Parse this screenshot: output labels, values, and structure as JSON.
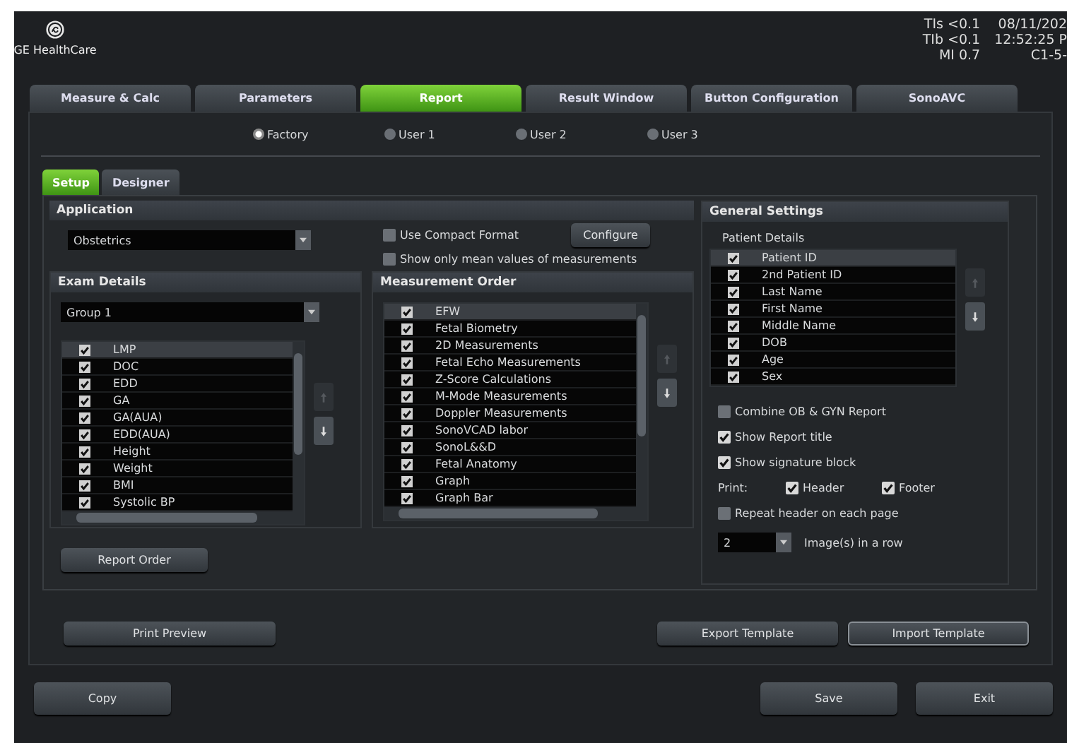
{
  "header": {
    "logo_text": "GE HealthCare",
    "indices": [
      "TIs <0.1",
      "TIb <0.1",
      "MI 0.7"
    ],
    "date": "08/11/202",
    "time": "12:52:25 P",
    "probe": "C1-5-"
  },
  "tabs": [
    {
      "label": "Measure & Calc",
      "selected": false
    },
    {
      "label": "Parameters",
      "selected": false
    },
    {
      "label": "Report",
      "selected": true
    },
    {
      "label": "Result Window",
      "selected": false
    },
    {
      "label": "Button Configuration",
      "selected": false
    },
    {
      "label": "SonoAVC",
      "selected": false
    }
  ],
  "presets": [
    {
      "label": "Factory",
      "selected": true
    },
    {
      "label": "User 1",
      "selected": false
    },
    {
      "label": "User 2",
      "selected": false
    },
    {
      "label": "User 3",
      "selected": false
    }
  ],
  "sub_tabs": [
    {
      "label": "Setup",
      "selected": true
    },
    {
      "label": "Designer",
      "selected": false
    }
  ],
  "application": {
    "title": "Application",
    "value": "Obstetrics"
  },
  "format_options": [
    {
      "label": "Use Compact Format",
      "checked": false
    },
    {
      "label": "Show only mean values of measurements",
      "checked": false
    }
  ],
  "configure_button": "Configure",
  "exam_details": {
    "title": "Exam Details",
    "group": "Group 1",
    "move_buttons": [
      {
        "kind": "up",
        "disabled": true
      },
      {
        "kind": "down",
        "disabled": false
      }
    ],
    "items": [
      {
        "label": "LMP",
        "checked": true,
        "selected": true
      },
      {
        "label": "DOC",
        "checked": true,
        "selected": false
      },
      {
        "label": "EDD",
        "checked": true,
        "selected": false
      },
      {
        "label": "GA",
        "checked": true,
        "selected": false
      },
      {
        "label": "GA(AUA)",
        "checked": true,
        "selected": false
      },
      {
        "label": "EDD(AUA)",
        "checked": true,
        "selected": false
      },
      {
        "label": "Height",
        "checked": true,
        "selected": false
      },
      {
        "label": "Weight",
        "checked": true,
        "selected": false
      },
      {
        "label": "BMI",
        "checked": true,
        "selected": false
      },
      {
        "label": "Systolic BP",
        "checked": true,
        "selected": false
      }
    ]
  },
  "measurement_order": {
    "title": "Measurement Order",
    "move_buttons": [
      {
        "kind": "up",
        "disabled": true
      },
      {
        "kind": "down",
        "disabled": false
      }
    ],
    "items": [
      {
        "label": "EFW",
        "checked": true,
        "selected": true
      },
      {
        "label": "Fetal Biometry",
        "checked": true,
        "selected": false
      },
      {
        "label": "2D Measurements",
        "checked": true,
        "selected": false
      },
      {
        "label": "Fetal Echo Measurements",
        "checked": true,
        "selected": false
      },
      {
        "label": "Z-Score Calculations",
        "checked": true,
        "selected": false
      },
      {
        "label": "M-Mode Measurements",
        "checked": true,
        "selected": false
      },
      {
        "label": "Doppler Measurements",
        "checked": true,
        "selected": false
      },
      {
        "label": "SonoVCAD labor",
        "checked": true,
        "selected": false
      },
      {
        "label": "SonoL&&D",
        "checked": true,
        "selected": false
      },
      {
        "label": "Fetal Anatomy",
        "checked": true,
        "selected": false
      },
      {
        "label": "Graph",
        "checked": true,
        "selected": false
      },
      {
        "label": "Graph Bar",
        "checked": true,
        "selected": false
      }
    ]
  },
  "report_order_button": "Report Order",
  "general_settings": {
    "title": "General Settings",
    "patient_details_label": "Patient Details",
    "move_buttons": [
      {
        "kind": "up",
        "disabled": true
      },
      {
        "kind": "down",
        "disabled": false
      }
    ],
    "items": [
      {
        "label": "Patient ID",
        "checked": true,
        "selected": true
      },
      {
        "label": "2nd Patient ID",
        "checked": true,
        "selected": false
      },
      {
        "label": "Last Name",
        "checked": true,
        "selected": false
      },
      {
        "label": "First Name",
        "checked": true,
        "selected": false
      },
      {
        "label": "Middle Name",
        "checked": true,
        "selected": false
      },
      {
        "label": "DOB",
        "checked": true,
        "selected": false
      },
      {
        "label": "Age",
        "checked": true,
        "selected": false
      },
      {
        "label": "Sex",
        "checked": true,
        "selected": false
      }
    ],
    "options": [
      {
        "label": "Combine OB & GYN Report",
        "checked": false
      },
      {
        "label": "Show Report title",
        "checked": true
      },
      {
        "label": "Show signature block",
        "checked": true
      }
    ],
    "print_label": "Print:",
    "print_options": [
      {
        "label": "Header",
        "checked": true
      },
      {
        "label": "Footer",
        "checked": true
      }
    ],
    "repeat_header": {
      "label": "Repeat header on each page",
      "checked": false
    },
    "images_per_row": {
      "value": "2",
      "label": "Image(s) in a row"
    }
  },
  "panel_buttons": [
    "Print Preview",
    "Export Template",
    "Import Template"
  ],
  "bottom_buttons": [
    "Copy",
    "Save",
    "Exit"
  ]
}
